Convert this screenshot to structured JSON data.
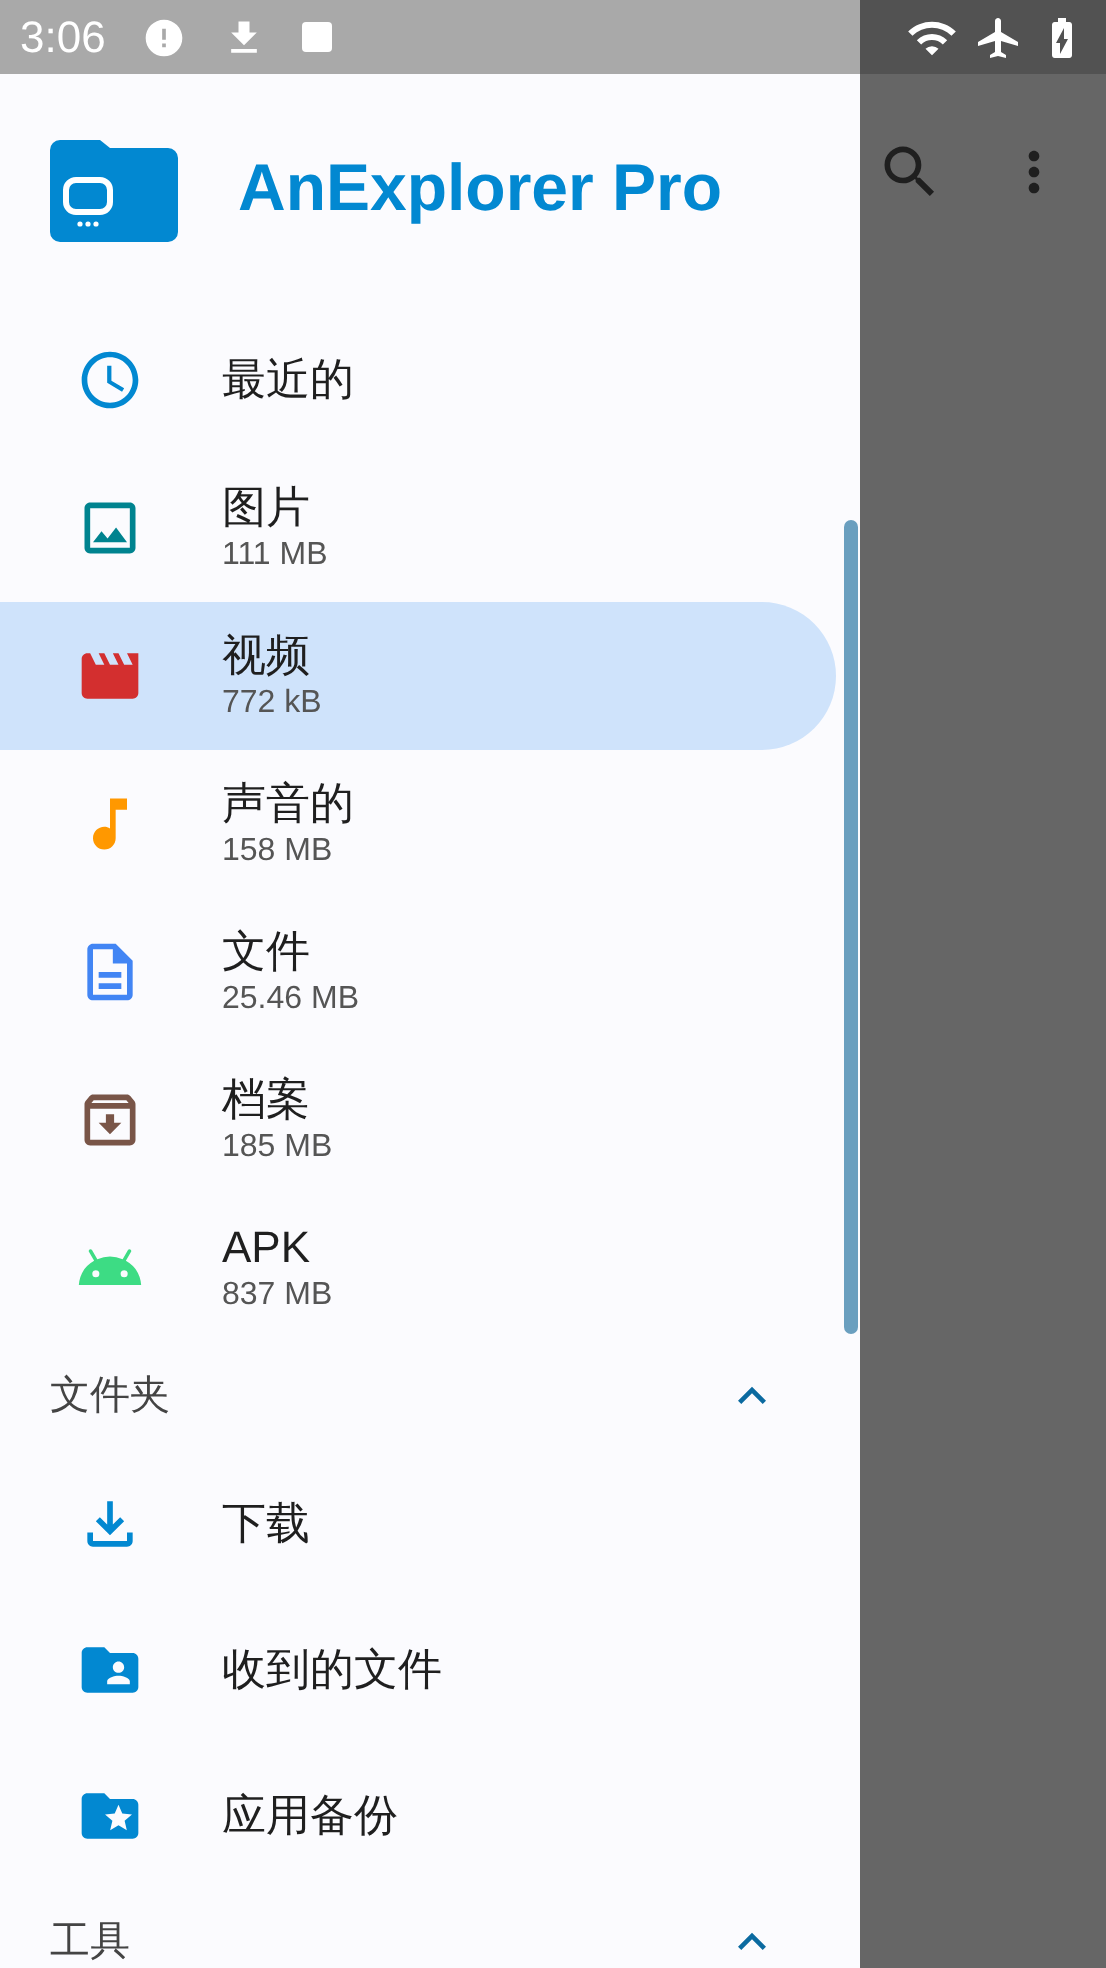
{
  "status_bar": {
    "time": "3:06"
  },
  "app": {
    "title": "AnExplorer Pro"
  },
  "library": [
    {
      "label": "最近的",
      "selected": false
    },
    {
      "label": "图片",
      "size": "111 MB",
      "selected": false
    },
    {
      "label": "视频",
      "size": "772 kB",
      "selected": true
    },
    {
      "label": "声音的",
      "size": "158 MB",
      "selected": false
    },
    {
      "label": "文件",
      "size": "25.46 MB",
      "selected": false
    },
    {
      "label": "档案",
      "size": "185 MB",
      "selected": false
    },
    {
      "label": "APK",
      "size": "837 MB",
      "selected": false
    }
  ],
  "sections": [
    {
      "title": "文件夹",
      "expanded": true,
      "items": [
        {
          "label": "下载",
          "selected": false
        },
        {
          "label": "收到的文件",
          "selected": false
        },
        {
          "label": "应用备份",
          "selected": false
        }
      ]
    },
    {
      "title": "工具",
      "expanded": true
    }
  ]
}
